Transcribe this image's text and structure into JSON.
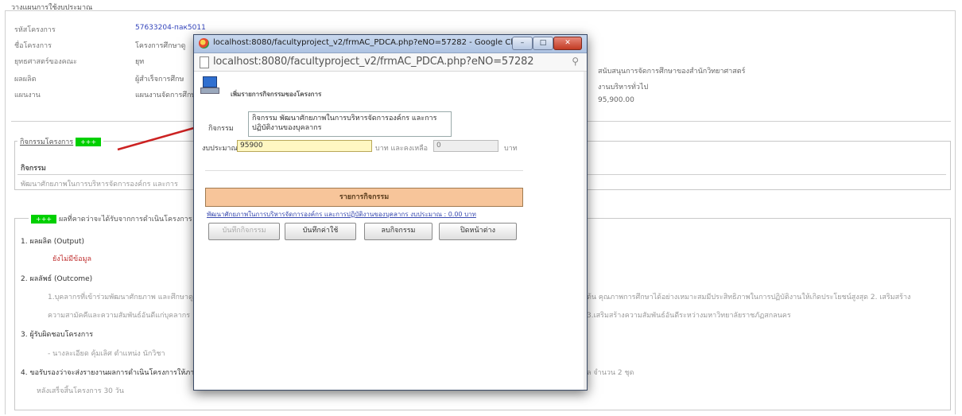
{
  "background": {
    "title": "วางแผนการใช้งบประมาณ",
    "rows": [
      {
        "label": "รหัสโครงการ",
        "value": "57633204-пак5011"
      },
      {
        "label": "ชื่อโครงการ",
        "value": "โครงการศึกษาดู"
      },
      {
        "label": "ยุทธศาสตร์ของคณะ",
        "value": "ยุท"
      },
      {
        "label": "ผลผลิต",
        "value": "ผู้สำเร็จการศึกษ"
      },
      {
        "label": "แผนงาน",
        "value": "แผนงานจัดการศึกษ"
      }
    ],
    "right_values": [
      "สนับสนุนการจัดการศึกษาของสำนักวิทยาศาสตร์",
      "งานบริหารทั่วไป",
      "95,900.00"
    ],
    "activities_legend": "กิจกรรมโครงการ",
    "activities_badge": "+++",
    "activities_header": "กิจกรรม",
    "activities_row": "พัฒนาศักยภาพในการบริหารจัดการองค์กร และการ",
    "outcome_badge": "+++",
    "outcome_legend": "ผลที่คาดว่าจะได้รับจากการดำเนินโครงการ",
    "output_heading": "1. ผลผลิต (Output)",
    "output_nodata": "ยังไม่มีข้อมูล",
    "outcome_heading": "2. ผลลัพธ์ (Outcome)",
    "outcome_line1": "1.บุคลากรที่เข้าร่วมพัฒนาศักยภาพ และศึกษาดูงาน",
    "outcome_line1_right": "ต้น คุณภาพการศึกษาได้อย่างเหมาะสมมีประสิทธิภาพในการปฏิบัติงานให้เกิดประโยชน์สูงสุด 2. เสริมสร้าง",
    "outcome_line2": "ความสามัคคีและความสัมพันธ์อันดีแก่บุคลากร",
    "outcome_line2_right": "3.เสริมสร้างความสัมพันธ์อันดีระหว่างมหาวิทยาลัยราชภัฏสกลนคร",
    "responsible_heading": "3. ผู้รับผิดชอบโครงการ",
    "responsible_line": "- นางละเอียด คุ้มเลิศ ตำแหน่ง นักวิชา",
    "report_heading": "4. ขอรับรองว่าจะส่งรายงานผลการดำเนินโครงการให้ภายใน",
    "report_right": "ล จำนวน 2 ชุด",
    "report_line": "หลังเสร็จสิ้นโครงการ 30 วัน"
  },
  "popup": {
    "window_title": "localhost:8080/facultyproject_v2/frmAC_PDCA.php?eNO=57282 - Google Chr...",
    "url": "localhost:8080/facultyproject_v2/frmAC_PDCA.php?eNO=57282",
    "heading": "เพิ่มรายการกิจกรรมของโครงการ",
    "activity_label": "กิจกรรม",
    "activity_value": "กิจกรรม พัฒนาศักยภาพในการบริหารจัดการองค์กร และการปฏิบัติงานของบุคลากร",
    "budget_label": "งบประมาณ",
    "budget_value": "95900",
    "remain_label": "บาท และคงเหลือ",
    "remain_value": "0",
    "unit_label": "บาท",
    "list_header": "รายการกิจกรรม",
    "list_item": "พัฒนาศักยภาพในการบริหารจัดการองค์กร และการปฏิบัติงานของบุคลากร งบประมาณ : 0.00 บาท",
    "buttons": {
      "save_activity": "บันทึกกิจกรรม",
      "save_expense": "บันทึกค่าใช้",
      "delete_activity": "ลบกิจกรรม",
      "close_window": "ปิดหน้าต่าง"
    }
  },
  "colors": {
    "badge_green": "#00d000",
    "budget_field": "#fff7c2",
    "list_header_bg": "#f7c59a",
    "arrow": "#cc2222"
  }
}
